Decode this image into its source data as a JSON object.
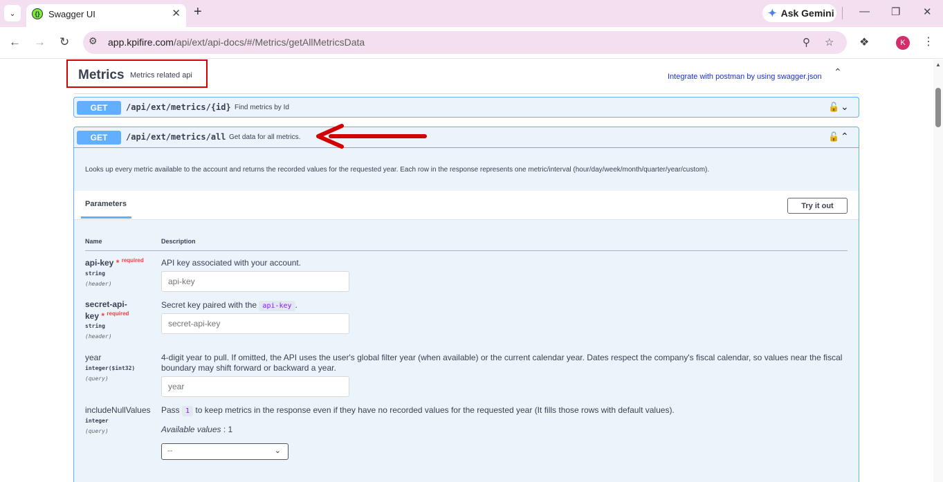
{
  "browser": {
    "tab_title": "Swagger UI",
    "new_tab_label": "+",
    "ask_gemini": "Ask Gemini",
    "url_host": "app.kpifire.com",
    "url_path": "/api/ext/api-docs/#/Metrics/getAllMetricsData",
    "profile_initial": "K"
  },
  "section": {
    "title": "Metrics",
    "description": "Metrics related api",
    "postman_link": "Integrate with postman by using swagger.json"
  },
  "operations": [
    {
      "method": "GET",
      "path": "/api/ext/metrics/{id}",
      "summary": "Find metrics by Id"
    },
    {
      "method": "GET",
      "path": "/api/ext/metrics/all",
      "summary": "Get data for all metrics."
    }
  ],
  "op_detail": {
    "description": "Looks up every metric available to the account and returns the recorded values for the requested year. Each row in the response represents one metric/interval (hour/day/week/month/quarter/year/custom).",
    "parameters_tab": "Parameters",
    "try_button": "Try it out",
    "col_name": "Name",
    "col_description": "Description",
    "required_star": "*",
    "required_label": "required",
    "params": [
      {
        "name": "api-key",
        "type": "string",
        "in": "(header)",
        "description": "API key associated with your account.",
        "placeholder": "api-key"
      },
      {
        "name_line1": "secret-api-",
        "name_line2": "key",
        "type": "string",
        "in": "(header)",
        "description": "Secret key paired with the",
        "code": "api-key",
        "description_end": ".",
        "placeholder": "secret-api-key"
      },
      {
        "name": "year",
        "type": "integer($int32)",
        "in": "(query)",
        "description": "4-digit year to pull. If omitted, the API uses the user's global filter year (when available) or the current calendar year. Dates respect the company's fiscal calendar, so values near the fiscal boundary may shift forward or backward a year.",
        "placeholder": "year"
      },
      {
        "name": "includeNullValues",
        "type": "integer",
        "in": "(query)",
        "description_pre": "Pass",
        "code": "1",
        "description_post": "to keep metrics in the response even if they have no recorded values for the requested year (It fills those rows with default values).",
        "available_label": "Available values",
        "available_value": ": 1",
        "select_value": "--"
      }
    ]
  },
  "colors": {
    "get_blue": "#61affe",
    "op_bg": "#ebf3fb",
    "annotation_red": "#d40000"
  }
}
